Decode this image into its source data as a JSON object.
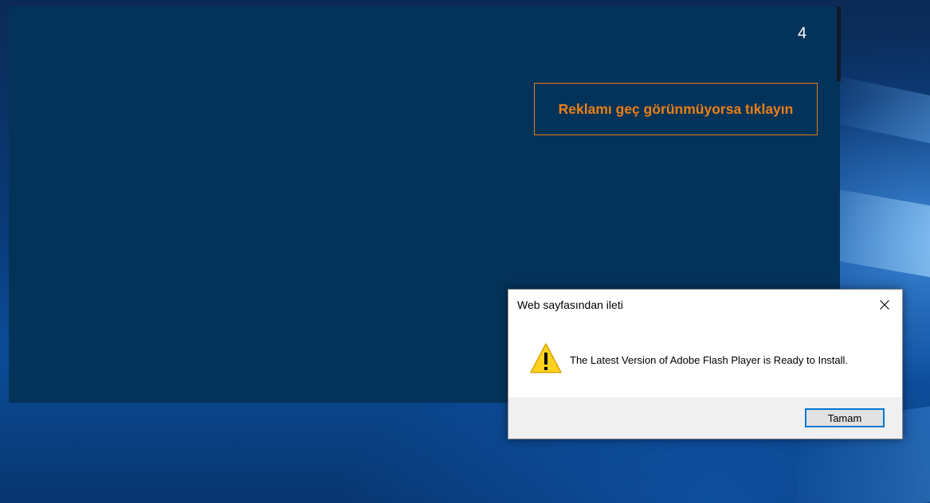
{
  "ad_page": {
    "countdown": "4",
    "skip_ad_label": "Reklamı geç görünmüyorsa tıklayın",
    "background_color": "#04335a",
    "accent_color": "#ec7f14"
  },
  "dialog": {
    "title": "Web sayfasından ileti",
    "message": "The Latest Version of Adobe Flash Player is Ready to Install.",
    "ok_label": "Tamam",
    "icon": "warning-icon",
    "close_icon": "close-icon"
  },
  "desktop": {
    "background_color": "#0a3a78"
  }
}
